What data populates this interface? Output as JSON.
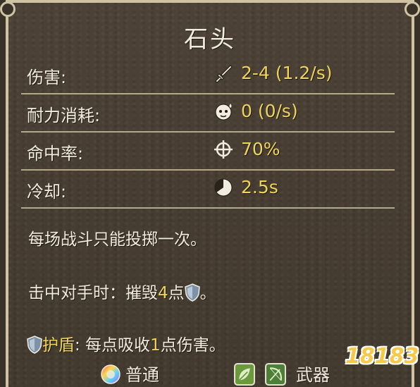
{
  "item": {
    "name": "石头"
  },
  "stats": [
    {
      "label": "伤害:",
      "icon": "sword-icon",
      "value": "2-4 (1.2/s)"
    },
    {
      "label": "耐力消耗:",
      "icon": "stamina-icon",
      "value": "0 (0/s)"
    },
    {
      "label": "命中率:",
      "icon": "crosshair-icon",
      "value": "70%"
    },
    {
      "label": "冷却:",
      "icon": "cooldown-icon",
      "value": "2.5s"
    }
  ],
  "description": {
    "line1": "每场战斗只能投掷一次。",
    "on_hit_prefix": "击中对手时：摧毁",
    "on_hit_amount": "4",
    "on_hit_suffix": "点",
    "on_hit_end": "。",
    "shield_keyword": "护盾",
    "shield_text_prefix": ": 每点吸收",
    "shield_amount": "1",
    "shield_text_suffix": "点伤害。"
  },
  "footer": {
    "rarity_label": "普通",
    "category_label": "武器"
  },
  "colors": {
    "highlight": "#eed45a",
    "text": "#f1ecdf",
    "frame": "#cfc3a4"
  },
  "watermark": {
    "text": "18183"
  }
}
